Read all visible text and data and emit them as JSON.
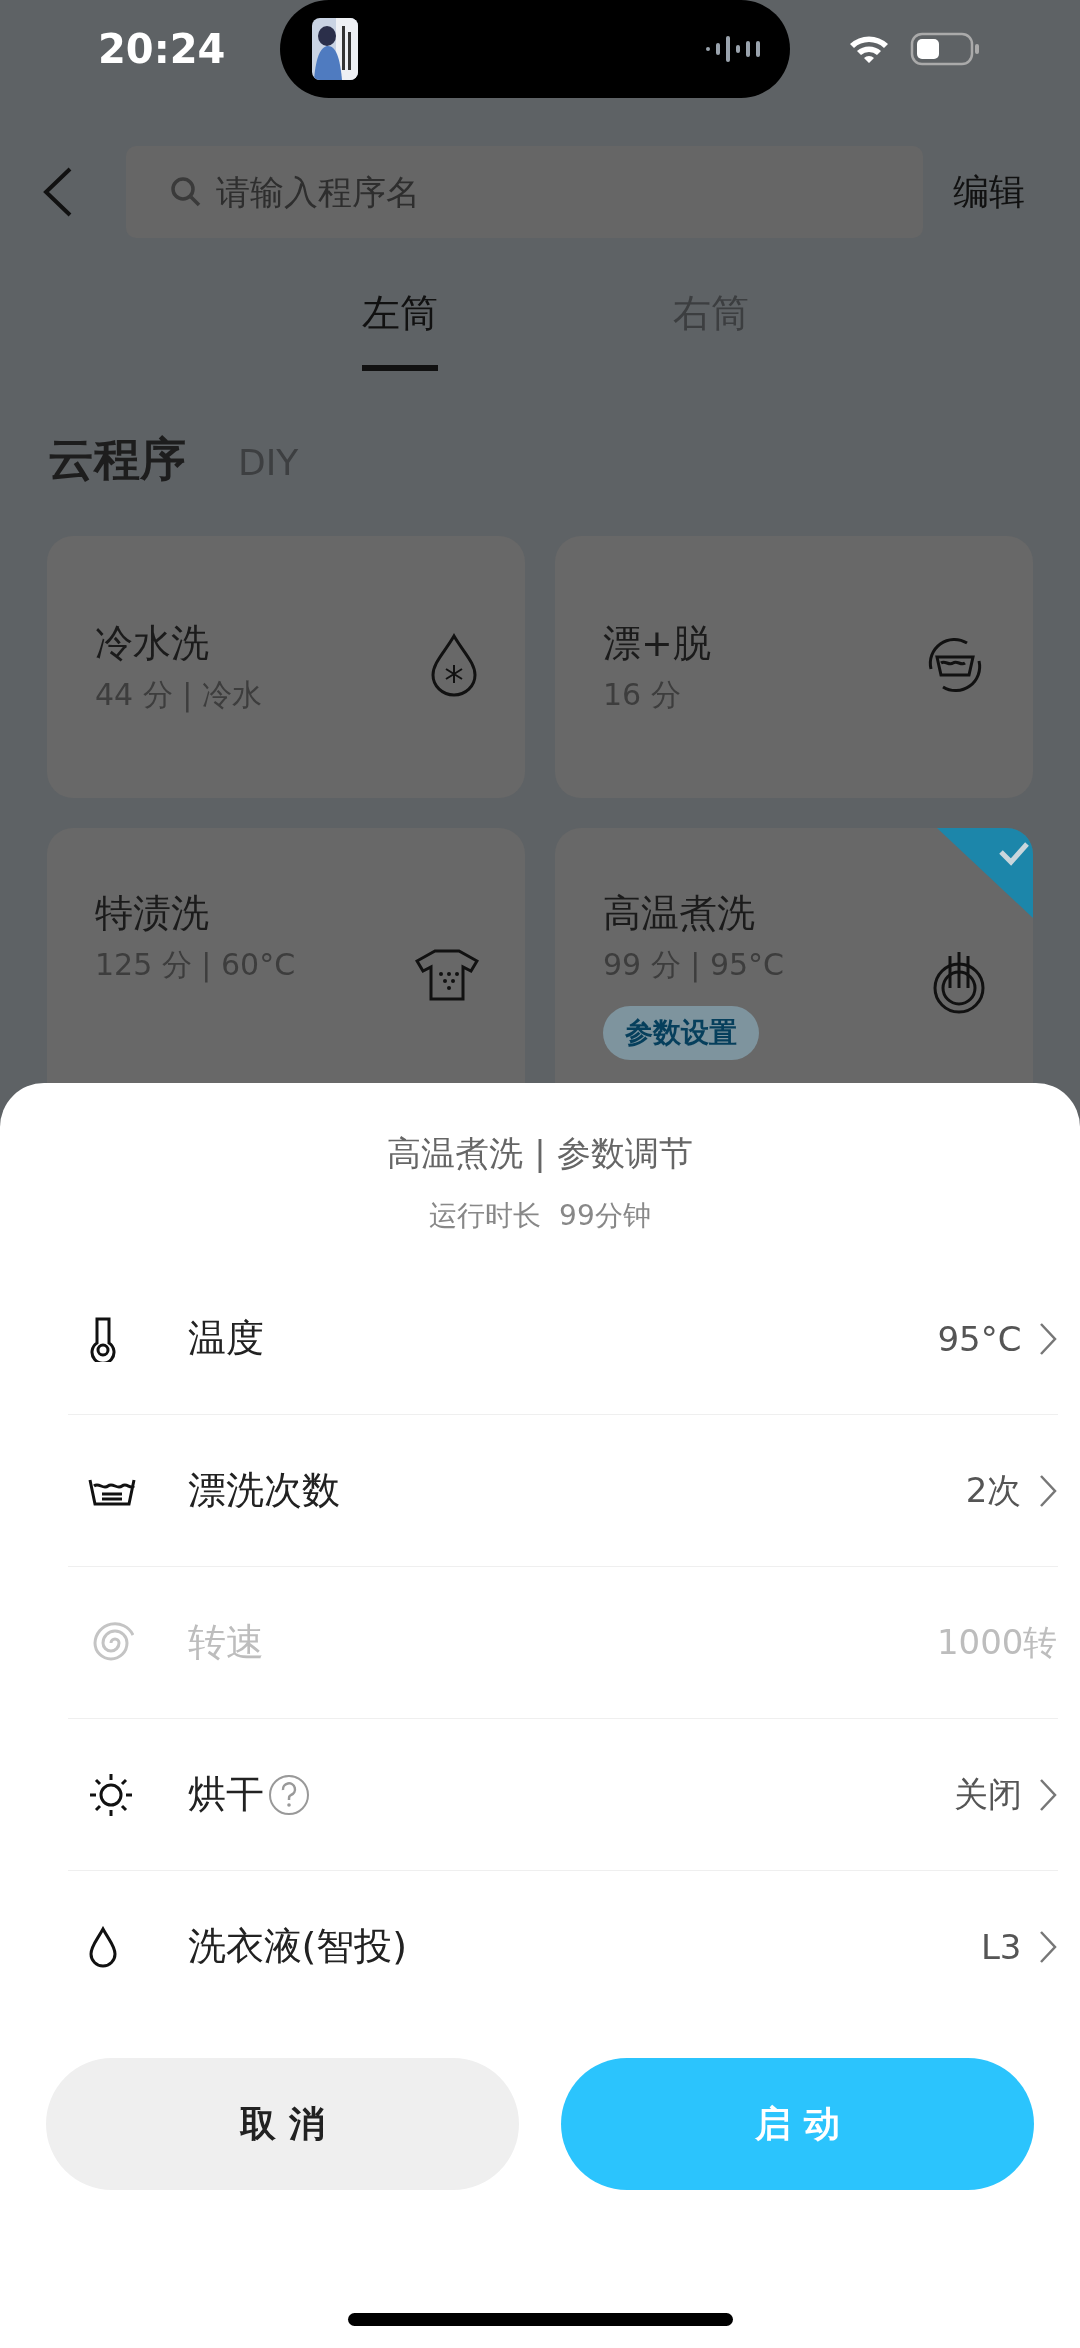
{
  "status_bar": {
    "time": "20:24"
  },
  "header": {
    "search": {
      "placeholder": "请输入程序名"
    },
    "edit": "编辑"
  },
  "tabs": [
    {
      "label": "左筒",
      "selected": true
    },
    {
      "label": "右筒",
      "selected": false
    }
  ],
  "sections": [
    {
      "label": "云程序",
      "selected": true
    },
    {
      "label": "DIY",
      "selected": false
    }
  ],
  "programs": [
    {
      "name": "冷水洗",
      "detail": "44 分 | 冷水",
      "kind": "cold",
      "selected": false
    },
    {
      "name": "漂+脱",
      "detail": "16 分",
      "kind": "rinse",
      "selected": false
    },
    {
      "name": "特渍洗",
      "detail": "125 分 | 60°C",
      "kind": "stain",
      "selected": false
    },
    {
      "name": "高温煮洗",
      "detail": "99 分 | 95°C",
      "kind": "boil",
      "selected": true,
      "action": "参数设置"
    }
  ],
  "sheet": {
    "title": "高温煮洗 | 参数调节",
    "subtitle": "运行时长  99分钟",
    "params": [
      {
        "label": "温度",
        "value": "95°C",
        "kind": "temperature",
        "disabled": false,
        "help": false
      },
      {
        "label": "漂洗次数",
        "value": "2次",
        "kind": "rinse",
        "disabled": false,
        "help": false
      },
      {
        "label": "转速",
        "value": "1000转",
        "kind": "speed",
        "disabled": true,
        "help": false
      },
      {
        "label": "烘干",
        "value": "关闭",
        "kind": "dry",
        "disabled": false,
        "help": true
      },
      {
        "label": "洗衣液(智投)",
        "value": "L3",
        "kind": "detergent",
        "disabled": false,
        "help": false
      }
    ],
    "buttons": [
      {
        "label": "取 消",
        "kind": "secondary"
      },
      {
        "label": "启 动",
        "kind": "primary"
      }
    ]
  }
}
